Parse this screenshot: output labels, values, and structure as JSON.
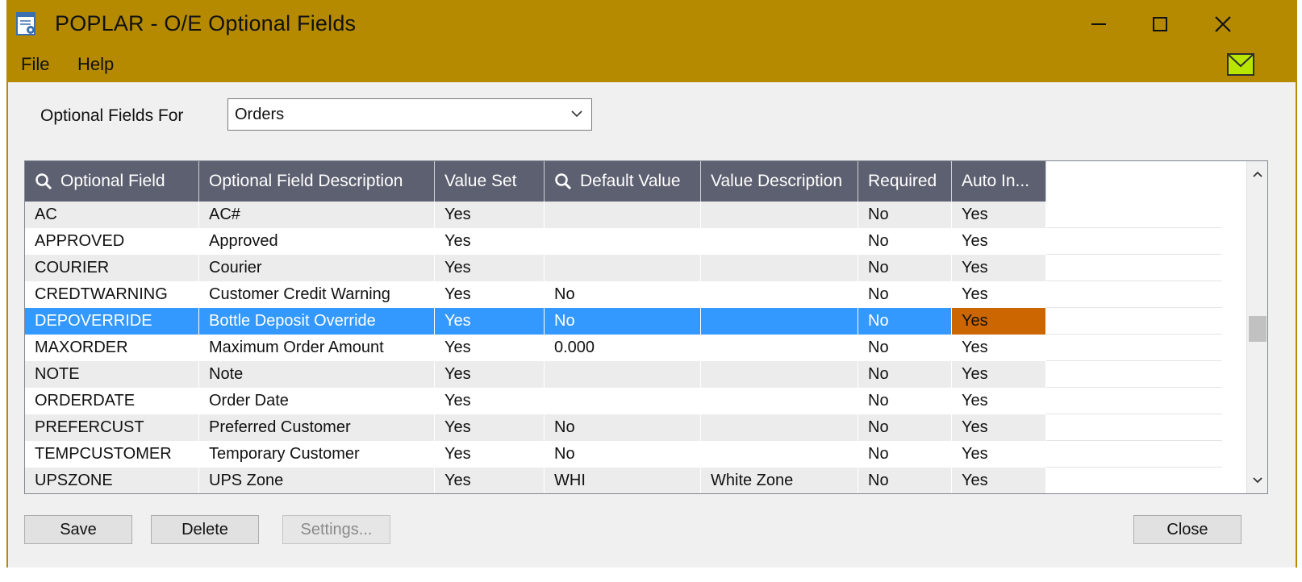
{
  "window": {
    "title": "POPLAR - O/E Optional Fields",
    "accent_color": "#b58a00"
  },
  "menu": {
    "file": "File",
    "help": "Help"
  },
  "form": {
    "optional_fields_for_label": "Optional Fields For",
    "optional_fields_for_value": "Orders"
  },
  "grid": {
    "columns": [
      "Optional Field",
      "Optional Field Description",
      "Value Set",
      "Default Value",
      "Value Description",
      "Required",
      "Auto In..."
    ],
    "selected_row_index": 4,
    "rows": [
      [
        "AC",
        "AC#",
        "Yes",
        "",
        "",
        "No",
        "Yes"
      ],
      [
        "APPROVED",
        "Approved",
        "Yes",
        "",
        "",
        "No",
        "Yes"
      ],
      [
        "COURIER",
        "Courier",
        "Yes",
        "",
        "",
        "No",
        "Yes"
      ],
      [
        "CREDTWARNING",
        "Customer Credit Warning",
        "Yes",
        "No",
        "",
        "No",
        "Yes"
      ],
      [
        "DEPOVERRIDE",
        "Bottle Deposit Override",
        "Yes",
        "No",
        "",
        "No",
        "Yes"
      ],
      [
        "MAXORDER",
        "Maximum Order Amount",
        "Yes",
        "0.000",
        "",
        "No",
        "Yes"
      ],
      [
        "NOTE",
        "Note",
        "Yes",
        "",
        "",
        "No",
        "Yes"
      ],
      [
        "ORDERDATE",
        "Order Date",
        "Yes",
        "",
        "",
        "No",
        "Yes"
      ],
      [
        "PREFERCUST",
        "Preferred Customer",
        "Yes",
        "No",
        "",
        "No",
        "Yes"
      ],
      [
        "TEMPCUSTOMER",
        "Temporary Customer",
        "Yes",
        "No",
        "",
        "No",
        "Yes"
      ],
      [
        "UPSZONE",
        "UPS Zone",
        "Yes",
        "WHI",
        "White Zone",
        "No",
        "Yes"
      ]
    ]
  },
  "buttons": {
    "save": "Save",
    "delete": "Delete",
    "settings": "Settings...",
    "close": "Close"
  },
  "icons": {
    "app": "document-gear-icon",
    "search": "search-icon",
    "mail": "mail-icon"
  },
  "colors": {
    "header_bg": "#5d6070",
    "selected_row": "#3399ff",
    "selected_cell": "#cc6600"
  }
}
